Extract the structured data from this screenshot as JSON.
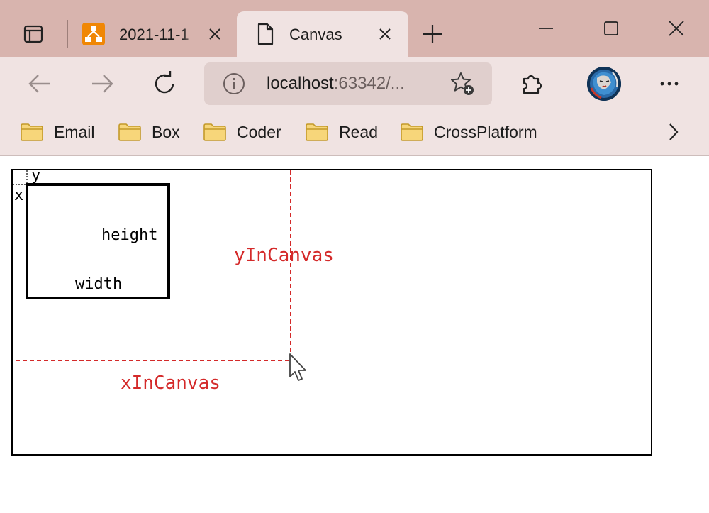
{
  "browser": {
    "tabs": [
      {
        "title": "2021-11-1",
        "icon": "drawio-icon",
        "active": false
      },
      {
        "title": "Canvas",
        "icon": "page-icon",
        "active": true
      }
    ],
    "address": {
      "host": "localhost",
      "rest": ":63342/..."
    },
    "favorites": [
      "Email",
      "Box",
      "Coder",
      "Read",
      "CrossPlatform"
    ],
    "accent": "#d8b4ae",
    "toolbar_bg": "#f0e3e2"
  },
  "canvas": {
    "labels": {
      "x": "x",
      "y": "y",
      "height": "height",
      "width": "width",
      "yInCanvas": "yInCanvas",
      "xInCanvas": "xInCanvas"
    },
    "annotation_color": "#d42a2a"
  }
}
